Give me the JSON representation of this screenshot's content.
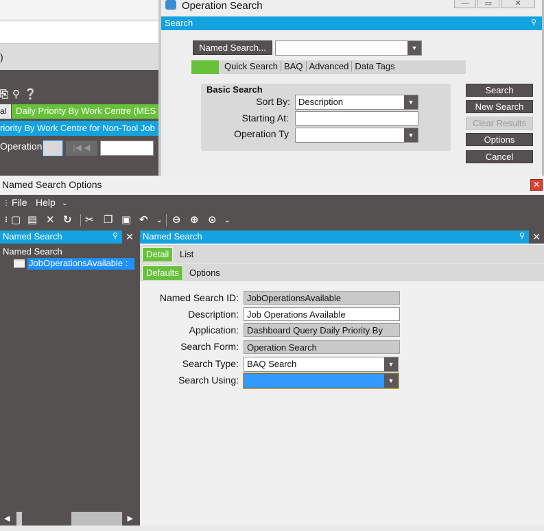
{
  "background_app": {
    "cut_label": ")",
    "tab_cut_label": "al",
    "active_tab": "Daily Priority By Work Centre (MES",
    "blue_bar": "riority By Work Centre for Non-Tool Job",
    "operation_label": "Operation:"
  },
  "operation_search": {
    "window_title": "Operation Search",
    "panel_title": "Search",
    "named_search_button": "Named Search...",
    "named_search_value": "",
    "tabs": [
      "Quick Search",
      "BAQ",
      "Advanced",
      "Data Tags"
    ],
    "basic_search": {
      "header": "Basic Search",
      "sort_by_label": "Sort By:",
      "sort_by_value": "Description",
      "starting_at_label": "Starting At:",
      "starting_at_value": "",
      "operation_type_label": "Operation Ty",
      "operation_type_value": ""
    },
    "buttons": {
      "search": "Search",
      "new_search": "New Search",
      "clear_results": "Clear Results",
      "options": "Options",
      "cancel": "Cancel"
    }
  },
  "named_search_options": {
    "window_title": "Named Search Options",
    "menu": {
      "file": "File",
      "help": "Help"
    },
    "left_pane": {
      "title": "Named Search",
      "tree_root": "Named Search",
      "tree_item": "JobOperationsAvailable :"
    },
    "right_pane": {
      "title": "Named Search",
      "tabs_row1": {
        "detail": "Detail",
        "list": "List"
      },
      "tabs_row2": {
        "defaults": "Defaults",
        "options": "Options"
      },
      "fields": {
        "named_search_id_label": "Named Search ID:",
        "named_search_id_value": "JobOperationsAvailable",
        "description_label": "Description:",
        "description_value": "Job Operations Available",
        "application_label": "Application:",
        "application_value": "Dashboard Query Daily Priority By",
        "search_form_label": "Search Form:",
        "search_form_value": "Operation Search",
        "search_type_label": "Search Type:",
        "search_type_value": "BAQ Search",
        "search_using_label": "Search Using:",
        "search_using_value": ""
      }
    }
  },
  "colors": {
    "header_blue": "#14a2e0",
    "tab_green": "#67c23a",
    "dark_gray": "#555150",
    "selection_blue": "#3399ff"
  },
  "icons": {
    "toolbar": [
      "new-icon",
      "save-icon",
      "delete-icon",
      "refresh-icon",
      "cut-icon",
      "copy-icon",
      "paste-icon",
      "undo-icon",
      "back-icon",
      "forward-icon",
      "home-icon"
    ]
  }
}
